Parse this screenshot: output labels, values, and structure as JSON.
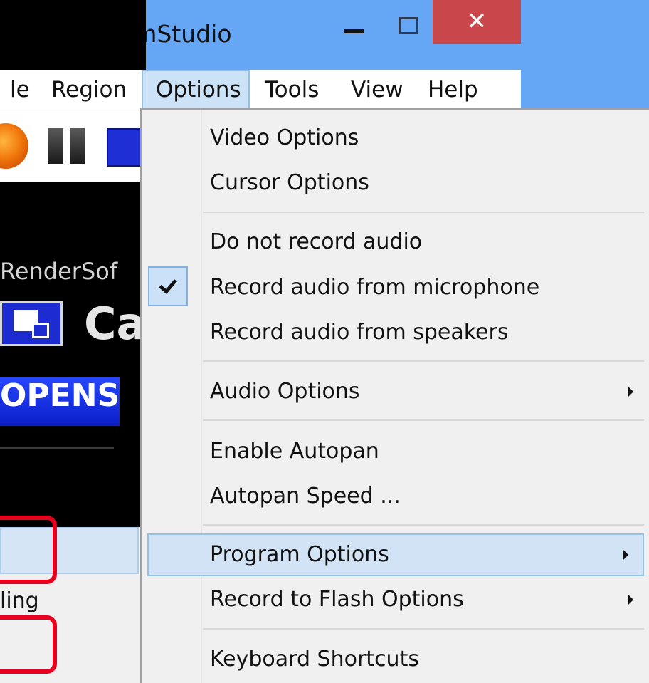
{
  "window": {
    "title": "CamStudio",
    "close_glyph": "✕"
  },
  "menubar": {
    "items": [
      "le",
      "Region",
      "Options",
      "Tools",
      "View",
      "Help"
    ],
    "active": "Options"
  },
  "toolbar": {
    "icons": [
      "record-icon",
      "pause-icon",
      "stop-icon"
    ]
  },
  "splash": {
    "publisher_text": "RenderSof",
    "logo_text": "Ca",
    "tagline_text": "OPENS"
  },
  "submenu": {
    "partial_item": "ling"
  },
  "options_menu": {
    "items": [
      {
        "label": "Video Options",
        "checked": false,
        "has_submenu": false,
        "highlighted": false
      },
      {
        "label": "Cursor Options",
        "checked": false,
        "has_submenu": false,
        "highlighted": false
      },
      {
        "label": "Do not record audio",
        "checked": false,
        "has_submenu": false,
        "highlighted": false
      },
      {
        "label": "Record audio from microphone",
        "checked": true,
        "has_submenu": false,
        "highlighted": false
      },
      {
        "label": "Record audio from speakers",
        "checked": false,
        "has_submenu": false,
        "highlighted": false
      },
      {
        "label": "Audio Options",
        "checked": false,
        "has_submenu": true,
        "highlighted": false
      },
      {
        "label": "Enable Autopan",
        "checked": false,
        "has_submenu": false,
        "highlighted": false
      },
      {
        "label": "Autopan Speed ...",
        "checked": false,
        "has_submenu": false,
        "highlighted": false
      },
      {
        "label": "Program Options",
        "checked": false,
        "has_submenu": true,
        "highlighted": true
      },
      {
        "label": "Record to Flash Options",
        "checked": false,
        "has_submenu": true,
        "highlighted": false
      },
      {
        "label": "Keyboard Shortcuts",
        "checked": false,
        "has_submenu": false,
        "highlighted": false
      }
    ]
  },
  "colors": {
    "title_bar": "#66a7f5",
    "close_button": "#c9474b",
    "menu_background": "#f0f0f0",
    "highlight": "#d1e3f4",
    "annotation": "#e8001e"
  }
}
